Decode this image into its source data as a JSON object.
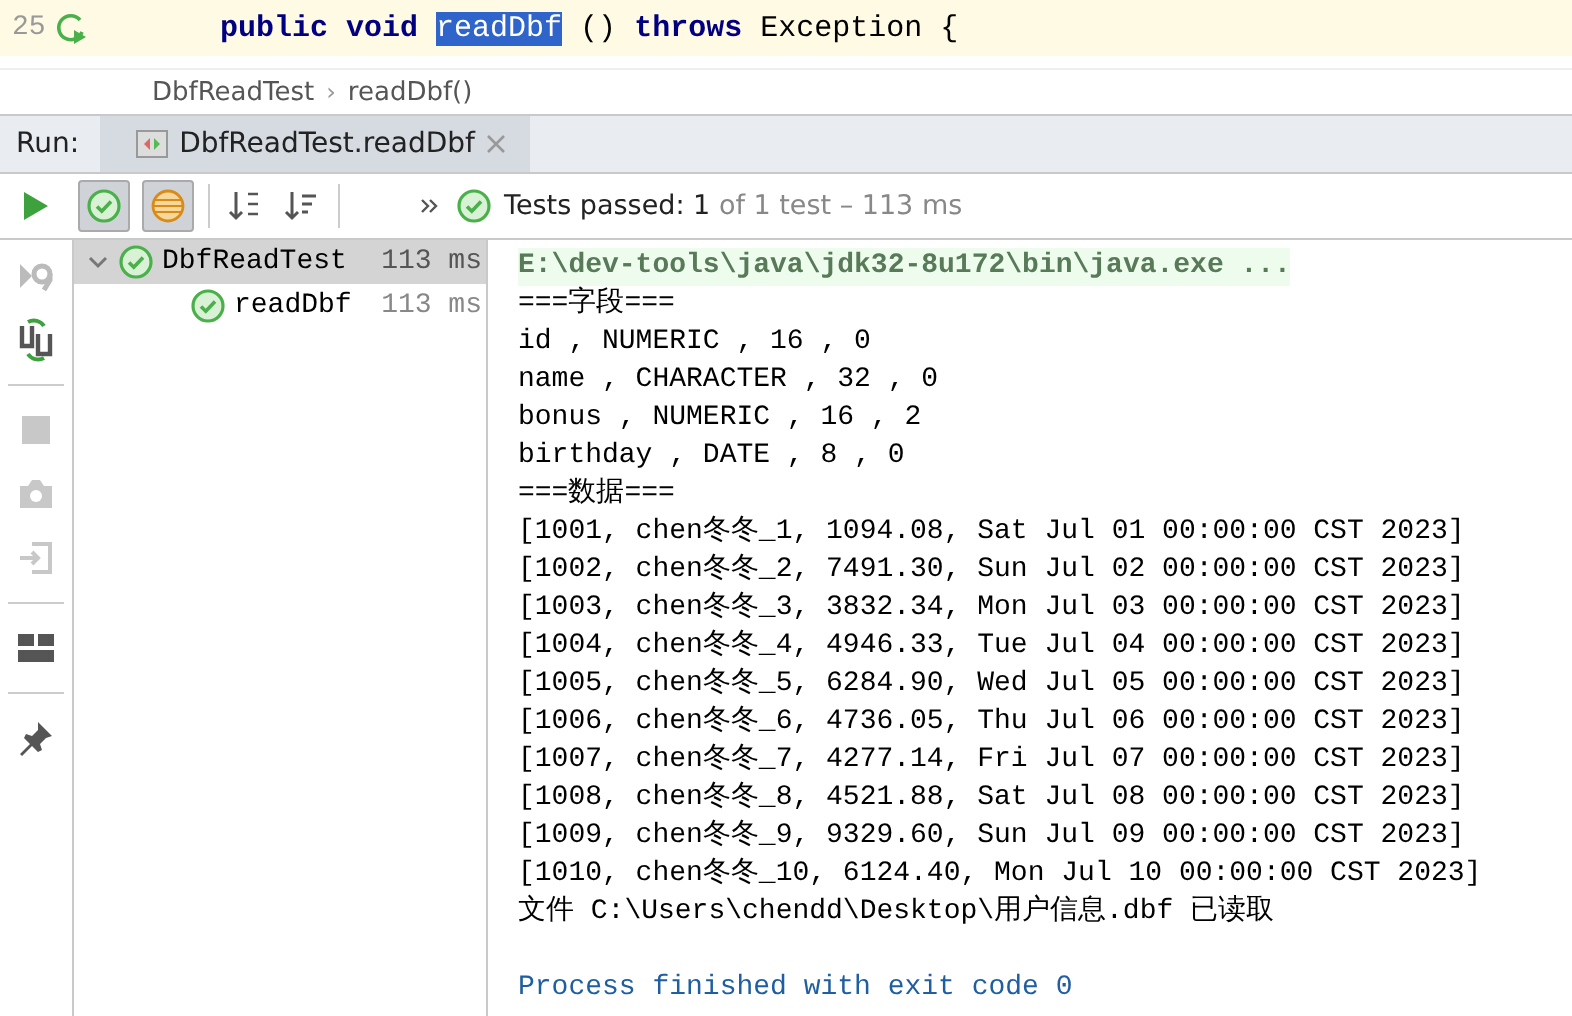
{
  "editor": {
    "line_number": "25",
    "code": [
      {
        "text": "public void",
        "kind": "keyword"
      },
      {
        "text": "readDbf",
        "kind": "selected"
      },
      {
        "text": "()",
        "kind": "plain"
      },
      {
        "text": "throws",
        "kind": "keyword"
      },
      {
        "text": "Exception {",
        "kind": "plain"
      }
    ]
  },
  "breadcrumbs": [
    {
      "label": "DbfReadTest"
    },
    {
      "label": "readDbf()"
    }
  ],
  "breadcrumb_separator": "›",
  "run_panel": {
    "label": "Run:",
    "tab": {
      "label": "DbfReadTest.readDbf",
      "selected": true
    }
  },
  "toolbar": {
    "show_passed": true,
    "show_ignored": true,
    "status": {
      "passed": "Tests passed:",
      "count": "1",
      "rest": "of 1 test – 113 ms"
    }
  },
  "tree": [
    {
      "label": "DbfReadTest",
      "time": "113 ms",
      "selected": true,
      "expanded": true,
      "children": [
        {
          "label": "readDbf",
          "time": "113 ms",
          "selected": false
        }
      ]
    }
  ],
  "console": [
    {
      "text": "E:\\dev-tools\\java\\jdk32-8u172\\bin\\java.exe ...",
      "kind": "command"
    },
    {
      "text": "===字段===",
      "kind": "output"
    },
    {
      "text": "id , NUMERIC , 16 , 0",
      "kind": "output"
    },
    {
      "text": "name , CHARACTER , 32 , 0",
      "kind": "output"
    },
    {
      "text": "bonus , NUMERIC , 16 , 2",
      "kind": "output"
    },
    {
      "text": "birthday , DATE , 8 , 0",
      "kind": "output"
    },
    {
      "text": "===数据===",
      "kind": "output"
    },
    {
      "text": "[1001, chen冬冬_1, 1094.08, Sat Jul 01 00:00:00 CST 2023]",
      "kind": "output"
    },
    {
      "text": "[1002, chen冬冬_2, 7491.30, Sun Jul 02 00:00:00 CST 2023]",
      "kind": "output"
    },
    {
      "text": "[1003, chen冬冬_3, 3832.34, Mon Jul 03 00:00:00 CST 2023]",
      "kind": "output"
    },
    {
      "text": "[1004, chen冬冬_4, 4946.33, Tue Jul 04 00:00:00 CST 2023]",
      "kind": "output"
    },
    {
      "text": "[1005, chen冬冬_5, 6284.90, Wed Jul 05 00:00:00 CST 2023]",
      "kind": "output"
    },
    {
      "text": "[1006, chen冬冬_6, 4736.05, Thu Jul 06 00:00:00 CST 2023]",
      "kind": "output"
    },
    {
      "text": "[1007, chen冬冬_7, 4277.14, Fri Jul 07 00:00:00 CST 2023]",
      "kind": "output"
    },
    {
      "text": "[1008, chen冬冬_8, 4521.88, Sat Jul 08 00:00:00 CST 2023]",
      "kind": "output"
    },
    {
      "text": "[1009, chen冬冬_9, 9329.60, Sun Jul 09 00:00:00 CST 2023]",
      "kind": "output"
    },
    {
      "text": "[1010, chen冬冬_10, 6124.40, Mon Jul 10 00:00:00 CST 2023]",
      "kind": "output"
    },
    {
      "text": "文件 C:\\Users\\chendd\\Desktop\\用户信息.dbf 已读取",
      "kind": "output"
    },
    {
      "kind": "blank"
    },
    {
      "text": "Process finished with exit code 0",
      "kind": "exit"
    }
  ]
}
